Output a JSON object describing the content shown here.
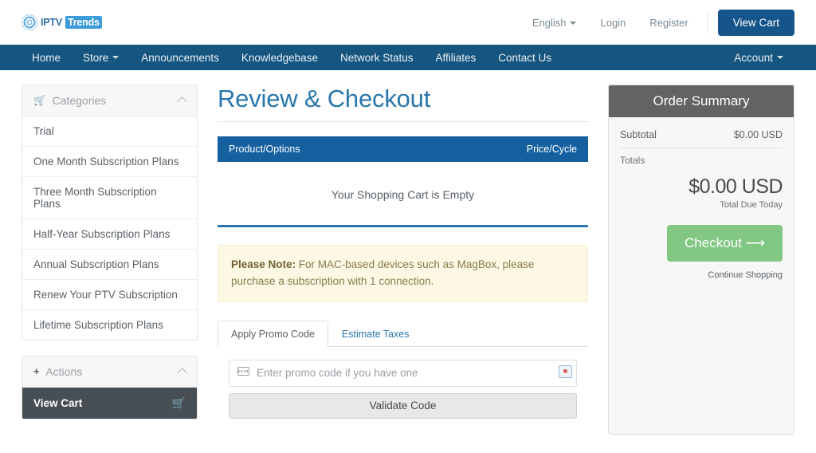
{
  "brand": {
    "iptv_text": "IPTV",
    "trends_text": "Trends",
    "logo_icon": "fingerprint-circle-icon"
  },
  "topbar": {
    "language": "English",
    "login": "Login",
    "register": "Register",
    "view_cart_button": "View Cart"
  },
  "mainnav": {
    "items": [
      {
        "label": "Home"
      },
      {
        "label": "Store",
        "has_caret": true
      },
      {
        "label": "Announcements"
      },
      {
        "label": "Knowledgebase"
      },
      {
        "label": "Network Status"
      },
      {
        "label": "Affiliates"
      },
      {
        "label": "Contact Us"
      }
    ],
    "account": "Account"
  },
  "sidebar": {
    "categories": {
      "title": "Categories",
      "icon": "cart-icon",
      "items": [
        {
          "label": "Trial"
        },
        {
          "label": "One Month Subscription Plans"
        },
        {
          "label": "Three Month Subscription Plans"
        },
        {
          "label": "Half-Year Subscription Plans"
        },
        {
          "label": "Annual Subscription Plans"
        },
        {
          "label": "Renew Your PTV Subscription"
        },
        {
          "label": "Lifetime Subscription Plans"
        }
      ]
    },
    "actions": {
      "title": "Actions",
      "icon": "plus-icon",
      "items": [
        {
          "label": "View Cart",
          "icon": "cart-icon",
          "active": true
        }
      ]
    }
  },
  "main": {
    "title": "Review & Checkout",
    "cart_header": {
      "product_options": "Product/Options",
      "price_cycle": "Price/Cycle"
    },
    "empty_message": "Your Shopping Cart is Empty",
    "note": {
      "label": "Please Note:",
      "text": " For MAC-based devices such as MagBox, please purchase a subscription with 1 connection."
    },
    "tabs": [
      {
        "label": "Apply Promo Code",
        "active": true
      },
      {
        "label": "Estimate Taxes",
        "active": false
      }
    ],
    "promo": {
      "placeholder": "Enter promo code if you have one",
      "value": "",
      "input_icon": "ticket-icon",
      "badge_icon": "autofill-badge-icon",
      "validate_button": "Validate Code"
    }
  },
  "summary": {
    "title": "Order Summary",
    "subtotal_label": "Subtotal",
    "subtotal_value": "$0.00 USD",
    "totals_label": "Totals",
    "grand_total": "$0.00 USD",
    "grand_total_sub": "Total Due Today",
    "checkout_button": "Checkout",
    "checkout_icon": "arrow-right-icon",
    "continue_shopping": "Continue Shopping"
  },
  "colors": {
    "nav_blue": "#15557f",
    "header_blue": "#1561a0",
    "title_blue": "#2a77ad",
    "summary_gray": "#636363",
    "checkout_green": "#82c784",
    "note_bg": "#fcf8e3",
    "active_item": "#474f54"
  }
}
